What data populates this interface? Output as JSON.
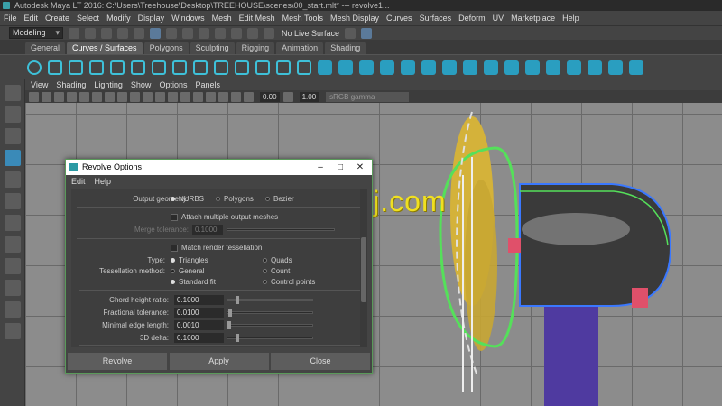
{
  "app": {
    "title": "Autodesk Maya LT 2016: C:\\Users\\Treehouse\\Desktop\\TREEHOUSE\\scenes\\00_start.mlt*  ---  revolve1..."
  },
  "menubar": [
    "File",
    "Edit",
    "Create",
    "Select",
    "Modify",
    "Display",
    "Windows",
    "Mesh",
    "Edit Mesh",
    "Mesh Tools",
    "Mesh Display",
    "Curves",
    "Surfaces",
    "Deform",
    "UV",
    "Marketplace",
    "Help"
  ],
  "statusline": {
    "mode": "Modeling",
    "live_surface": "No Live Surface"
  },
  "shelf_tabs": [
    {
      "label": "General",
      "active": false
    },
    {
      "label": "Curves / Surfaces",
      "active": true
    },
    {
      "label": "Polygons",
      "active": false
    },
    {
      "label": "Sculpting",
      "active": false
    },
    {
      "label": "Rigging",
      "active": false
    },
    {
      "label": "Animation",
      "active": false
    },
    {
      "label": "Shading",
      "active": false
    }
  ],
  "panel_menu": [
    "View",
    "Shading",
    "Lighting",
    "Show",
    "Options",
    "Panels"
  ],
  "panel_toolbar": {
    "near": "0.00",
    "far": "1.00",
    "color_space": "sRGB gamma"
  },
  "watermark": "www.cgtsj.com",
  "dialog": {
    "title": "Revolve Options",
    "menu": [
      "Edit",
      "Help"
    ],
    "output_geometry": {
      "label": "Output geometry:",
      "options": [
        "NURBS",
        "Polygons",
        "Bezier"
      ],
      "selected": "NURBS"
    },
    "attach": {
      "label": "Attach multiple output meshes"
    },
    "merge_tolerance": {
      "label": "Merge tolerance:",
      "value": "0.1000"
    },
    "match_tess": {
      "label": "Match render tessellation"
    },
    "type": {
      "label": "Type:",
      "options": [
        "Triangles",
        "Quads"
      ],
      "selected": "Triangles"
    },
    "tess_method": {
      "label": "Tessellation method:",
      "options": [
        "General",
        "Count",
        "Standard fit",
        "Control points"
      ],
      "selected": "Standard fit"
    },
    "chord_height": {
      "label": "Chord height ratio:",
      "value": "0.1000",
      "level": 0.1
    },
    "fractional": {
      "label": "Fractional tolerance:",
      "value": "0.0100",
      "level": 0.01
    },
    "min_edge": {
      "label": "Minimal edge length:",
      "value": "0.0010",
      "level": 0.001
    },
    "delta": {
      "label": "3D delta:",
      "value": "0.1000",
      "level": 0.1
    },
    "buttons": {
      "revolve": "Revolve",
      "apply": "Apply",
      "close": "Close"
    }
  }
}
